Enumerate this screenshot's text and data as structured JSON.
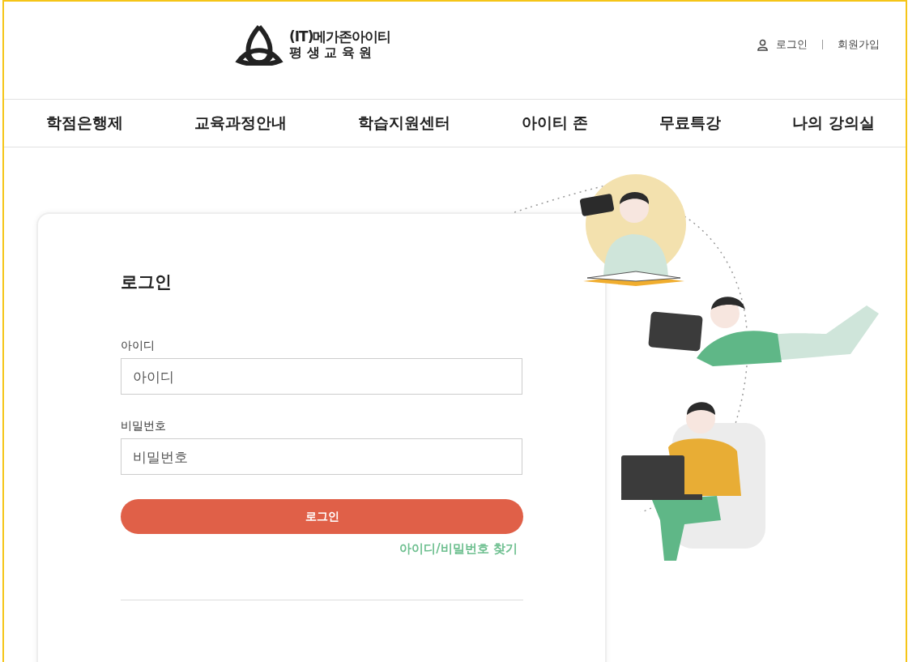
{
  "header": {
    "logo": {
      "line1": "(IT)메가존아이티",
      "line2": "평 생 교 육 원"
    },
    "user_links": [
      {
        "label": "로그인"
      },
      {
        "label": "회원가입"
      }
    ]
  },
  "nav": {
    "items": [
      {
        "label": "학점은행제"
      },
      {
        "label": "교육과정안내"
      },
      {
        "label": "학습지원센터"
      },
      {
        "label": "아이티 존"
      },
      {
        "label": "무료특강"
      },
      {
        "label": "나의 강의실"
      }
    ]
  },
  "login": {
    "title": "로그인",
    "fields": [
      {
        "label": "아이디",
        "placeholder": "아이디"
      },
      {
        "label": "비밀번호",
        "placeholder": "비밀번호"
      }
    ],
    "submit": "로그인",
    "find_link": "아이디/비밀번호 찾기"
  }
}
